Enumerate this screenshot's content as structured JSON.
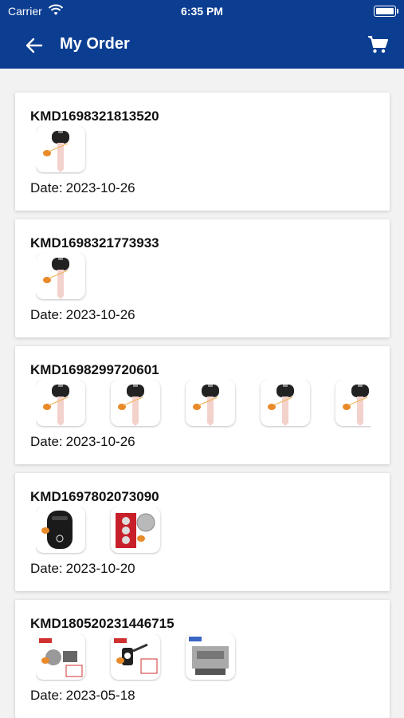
{
  "status_bar": {
    "carrier": "Carrier",
    "time": "6:35 PM"
  },
  "navbar": {
    "title": "My Order"
  },
  "date_label": "Date:",
  "orders": [
    {
      "id": "KMD1698321813520",
      "date": "2023-10-26",
      "items": [
        "key-blade"
      ]
    },
    {
      "id": "KMD1698321773933",
      "date": "2023-10-26",
      "items": [
        "key-blade"
      ]
    },
    {
      "id": "KMD1698299720601",
      "date": "2023-10-26",
      "items": [
        "key-blade",
        "key-blade",
        "key-blade",
        "key-blade",
        "key-blade"
      ]
    },
    {
      "id": "KMD1697802073090",
      "date": "2023-10-20",
      "items": [
        "remote-fob",
        "coin-batteries"
      ]
    },
    {
      "id": "KMD180520231446715",
      "date": "2023-05-18",
      "items": [
        "key-machine-kit",
        "key-programmer-kit",
        "key-cutting-machine"
      ]
    }
  ],
  "colors": {
    "header": "#0b3d91",
    "card": "#ffffff",
    "background": "#f2f2f2"
  }
}
